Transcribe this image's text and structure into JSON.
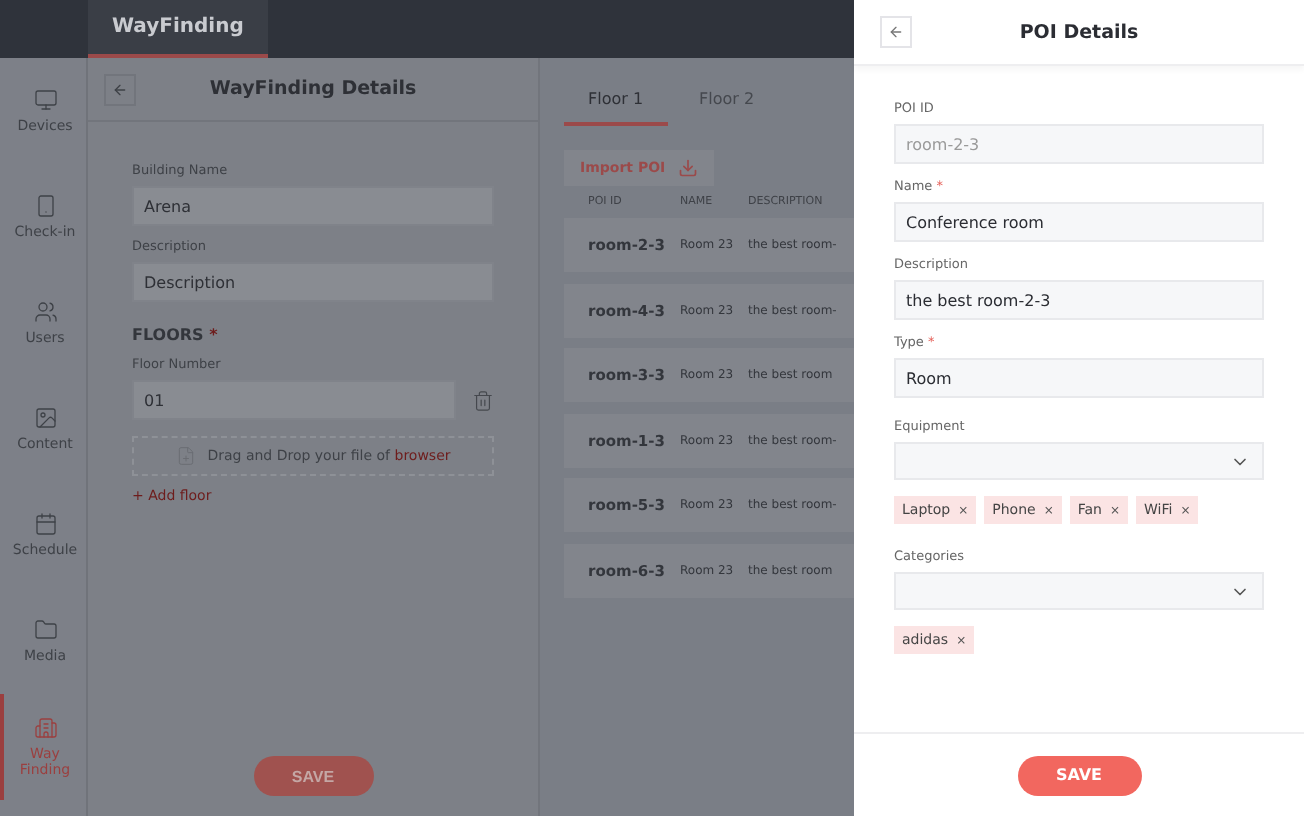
{
  "top_tab": {
    "label": "WayFinding",
    "selected": true
  },
  "sidebar": {
    "items": [
      {
        "label": "Devices",
        "selected": false
      },
      {
        "label": "Check-in",
        "selected": false
      },
      {
        "label": "Users",
        "selected": false
      },
      {
        "label": "Content",
        "selected": false
      },
      {
        "label": "Schedule",
        "selected": false
      },
      {
        "label": "Media",
        "selected": false
      },
      {
        "label": "Way Finding",
        "selected": true
      }
    ]
  },
  "details": {
    "title": "WayFinding Details",
    "building_label": "Building Name",
    "building_value": "Arena",
    "description_label": "Description",
    "description_value": "Description",
    "floors_heading": "FLOORS",
    "required_mark": "*",
    "floor_label": "Floor Number",
    "floor_value": "01",
    "drop_text": "Drag and Drop your file of",
    "drop_link": "browser",
    "add_floor": "+ Add floor",
    "save": "SAVE"
  },
  "floor_tabs": [
    {
      "label": "Floor 1",
      "selected": true
    },
    {
      "label": "Floor 2",
      "selected": false
    }
  ],
  "import_button": "Import POI",
  "table": {
    "columns": [
      "POI ID",
      "NAME",
      "DESCRIPTION"
    ],
    "rows": [
      [
        "room-2-3",
        "Room 23",
        "the best room-"
      ],
      [
        "room-4-3",
        "Room 23",
        "the best room-"
      ],
      [
        "room-3-3",
        "Room 23",
        "the best room"
      ],
      [
        "room-1-3",
        "Room 23",
        "the best room-"
      ],
      [
        "room-5-3",
        "Room 23",
        "the best room-"
      ],
      [
        "room-6-3",
        "Room 23",
        "the best room"
      ]
    ]
  },
  "drawer": {
    "title": "POI Details",
    "fields": [
      {
        "label": "POI ID",
        "required": false,
        "value": "room-2-3",
        "disabled": true
      },
      {
        "label": "Name",
        "required": true,
        "value": "Conference room",
        "disabled": false
      },
      {
        "label": "Description",
        "required": false,
        "value": "the best room-2-3",
        "disabled": false
      },
      {
        "label": "Type",
        "required": true,
        "value": "Room",
        "disabled": false
      }
    ],
    "selects": [
      {
        "label": "Equipment",
        "tags": [
          "Laptop",
          "Phone",
          "Fan",
          "WiFi"
        ]
      },
      {
        "label": "Categories",
        "tags": [
          "adidas"
        ]
      }
    ],
    "tag_remove": "×",
    "required_mark": "*",
    "save": "SAVE"
  }
}
